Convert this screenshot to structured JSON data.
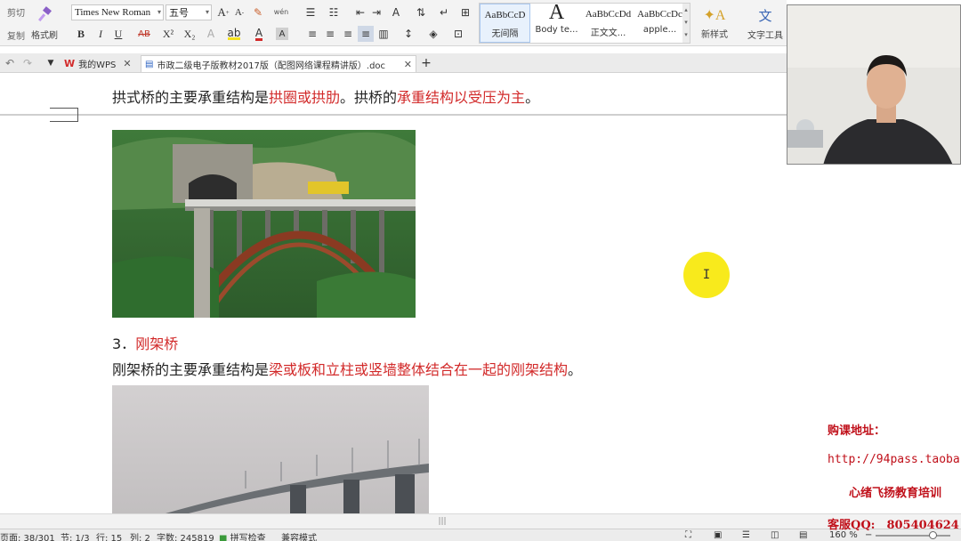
{
  "ribbon": {
    "cut_label": "剪切",
    "copy_label": "复制",
    "format_painter_label": "格式刷",
    "font_name": "Times New Roman",
    "font_size": "五号",
    "wen_label": "wén",
    "bold": "B",
    "italic": "I",
    "underline": "U",
    "strike": "AB",
    "superscript": "X²",
    "subscript": "X₂",
    "styles": [
      {
        "preview": "AaBbCcD",
        "name": "无间隔"
      },
      {
        "preview": "A",
        "name": "Body te..."
      },
      {
        "preview": "AaBbCcDd",
        "name": "正文文..."
      },
      {
        "preview": "AaBbCcDc",
        "name": "apple..."
      }
    ],
    "new_style_label": "新样式",
    "text_tools_label": "文字工具"
  },
  "tabs": {
    "home_label": "我的WPS",
    "doc_label": "市政二级电子版教材2017版（配图网络课程精讲版）.doc",
    "add": "+"
  },
  "document": {
    "line1_prefix": "拱式桥的主要承重结构是",
    "line1_red1": "拱圈或拱肋",
    "line1_mid": "。拱桥的",
    "line1_red2": "承重结构以受压为主",
    "line1_end": "。",
    "heading_num": "3．",
    "heading_text": "刚架桥",
    "line2_prefix": "刚架桥的主要承重结构是",
    "line2_red": "梁或板和立柱或竖墙整体结合在一起的刚架结构",
    "line2_end": "。",
    "cursor_glyph": "I"
  },
  "watermark": {
    "buy_label": "购课地址：",
    "url": "http://94pass.taoba",
    "org": "心绪飞扬教育培训",
    "qq": "客服QQ:　805404624"
  },
  "status": {
    "page": "页面: 38/301",
    "section": "节: 1/3",
    "row": "行: 15",
    "col": "列: 2",
    "words": "字数: 245819",
    "spell": "拼写检查",
    "compat": "兼容模式",
    "zoom": "160 %"
  },
  "colors": {
    "accent_red": "#d22a2a",
    "highlight_yellow": "#f8ea1c",
    "watermark_red": "#c0101a"
  }
}
